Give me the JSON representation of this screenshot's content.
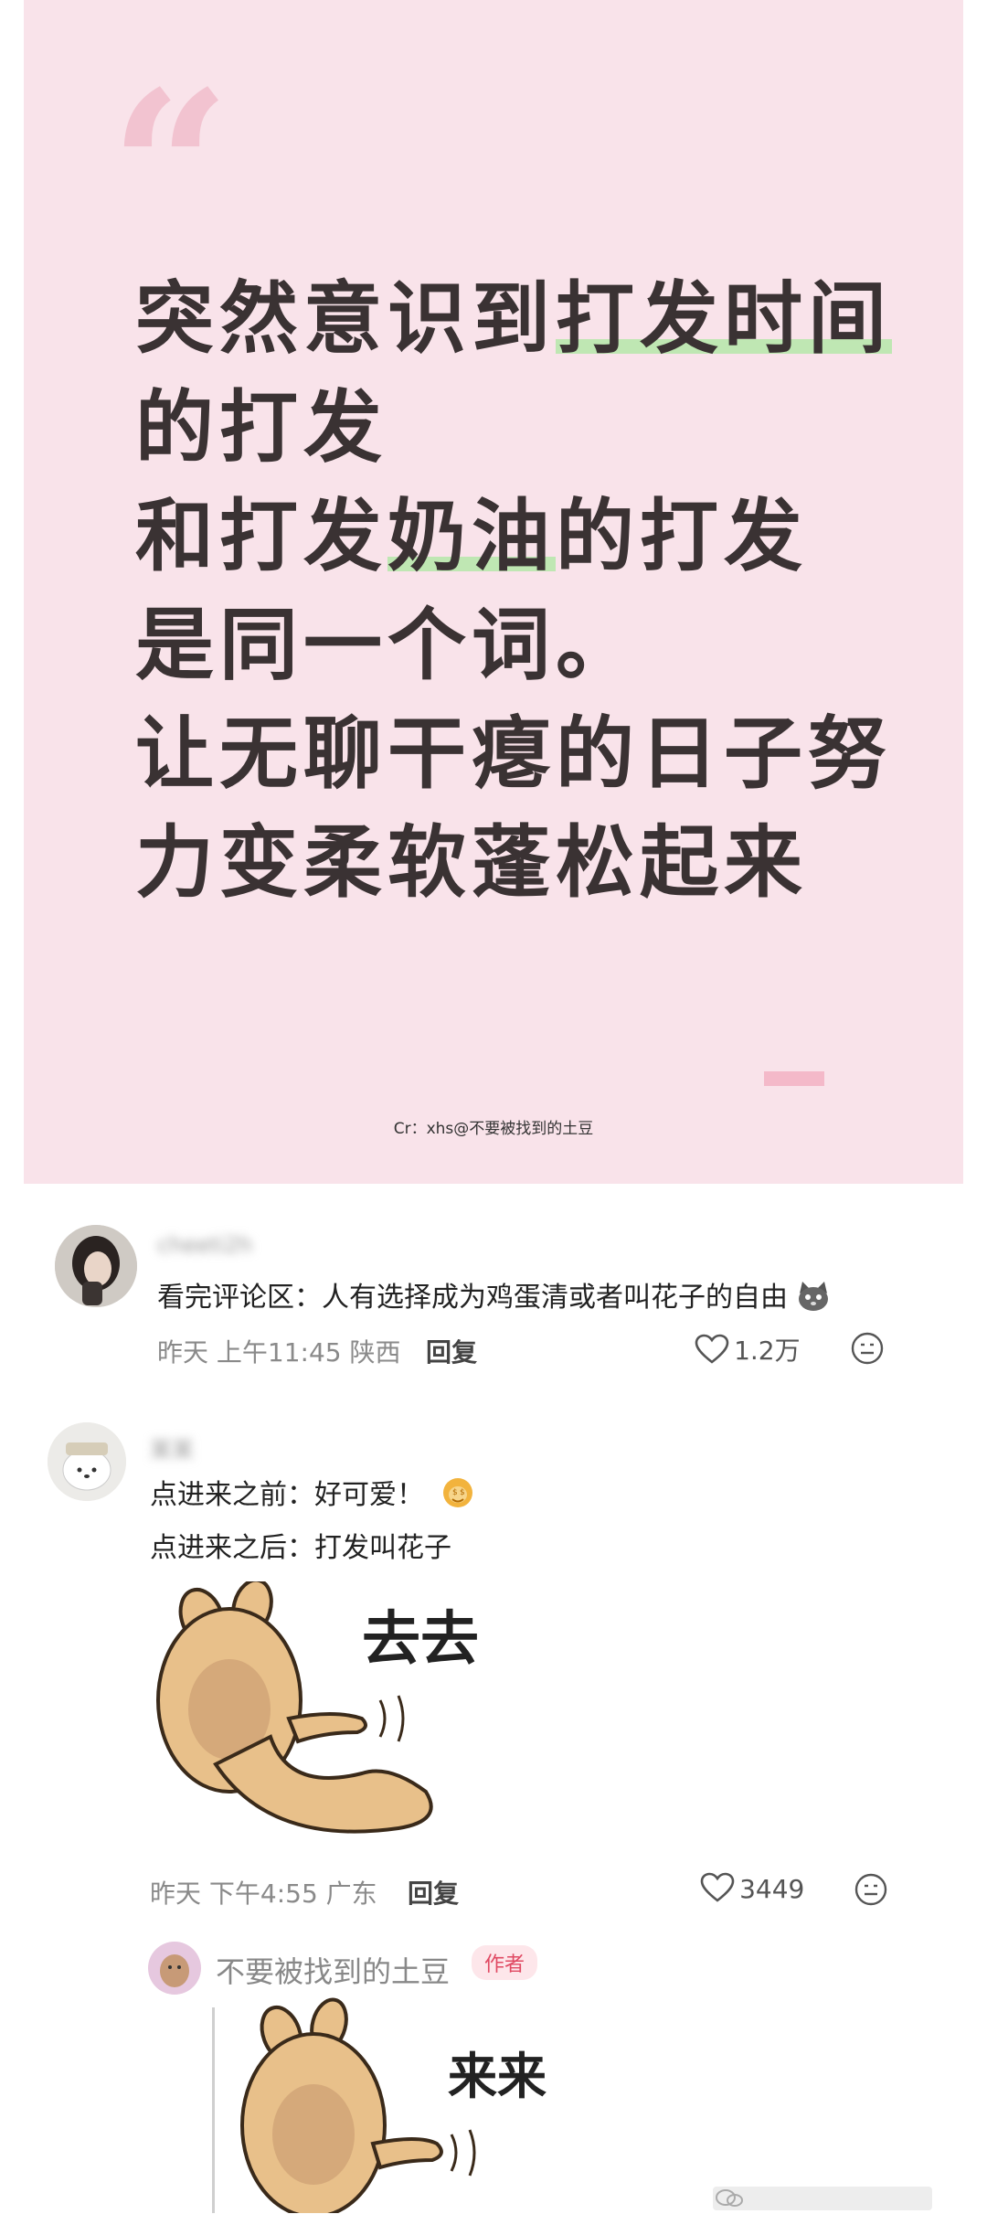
{
  "quote": {
    "mark": "“",
    "lines": [
      {
        "pre": "突然意识到",
        "hl": "打发时间",
        "post": ""
      },
      {
        "pre": "的打发",
        "hl": "",
        "post": ""
      },
      {
        "pre": "和打发",
        "hl": "奶油",
        "post": "的打发"
      },
      {
        "pre": "是同一个词。",
        "hl": "",
        "post": ""
      },
      {
        "pre": "让无聊干瘪的日子努",
        "hl": "",
        "post": ""
      },
      {
        "pre": "力变柔软蓬松起来",
        "hl": "",
        "post": ""
      }
    ],
    "credit": "Cr：xhs@不要被找到的土豆"
  },
  "comments": [
    {
      "username": "cheeti2h",
      "text": "看完评论区：人有选择成为鸡蛋清或者叫花子的自由",
      "meta": "昨天 上午11:45 陕西",
      "reply_label": "回复",
      "likes": "1.2万"
    },
    {
      "username": "某某",
      "text_lines": [
        "点进来之前：好可爱！",
        "点进来之后：打发叫花子"
      ],
      "sticker_text": "去去",
      "meta": "昨天 下午4:55 广东",
      "reply_label": "回复",
      "likes": "3449"
    }
  ],
  "author_reply": {
    "name": "不要被找到的土豆",
    "badge": "作者",
    "sticker_text": "来来"
  },
  "icons": [
    "heart-icon",
    "emoji-reaction-icon",
    "cat-emoji-icon",
    "money-face-emoji-icon",
    "wechat-watermark-icon"
  ]
}
